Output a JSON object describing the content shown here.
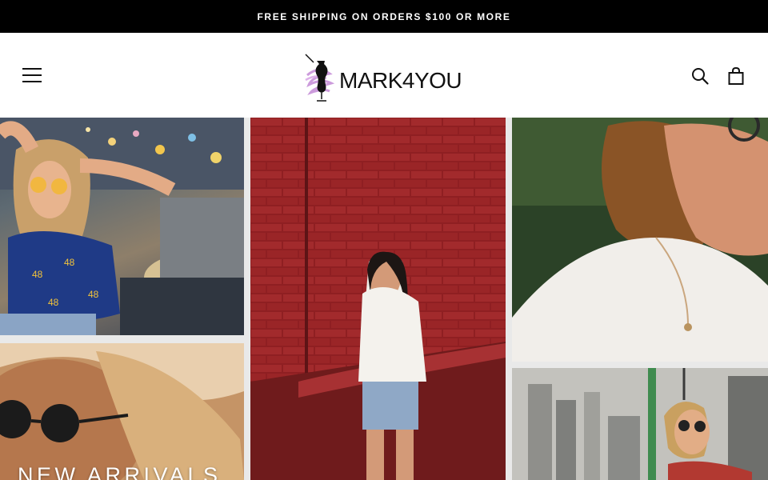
{
  "announcement": {
    "text": "FREE SHIPPING ON ORDERS $100 OR MORE"
  },
  "header": {
    "logo_text": "MARK4YOU",
    "menu_icon": "hamburger-menu-icon",
    "search_icon": "search-icon",
    "cart_icon": "shopping-bag-icon"
  },
  "hero": {
    "title": "NEW ARRIVALS"
  },
  "colors": {
    "announcement_bg": "#000000",
    "logo_accent": "#c38ad6",
    "text_primary": "#111111"
  }
}
